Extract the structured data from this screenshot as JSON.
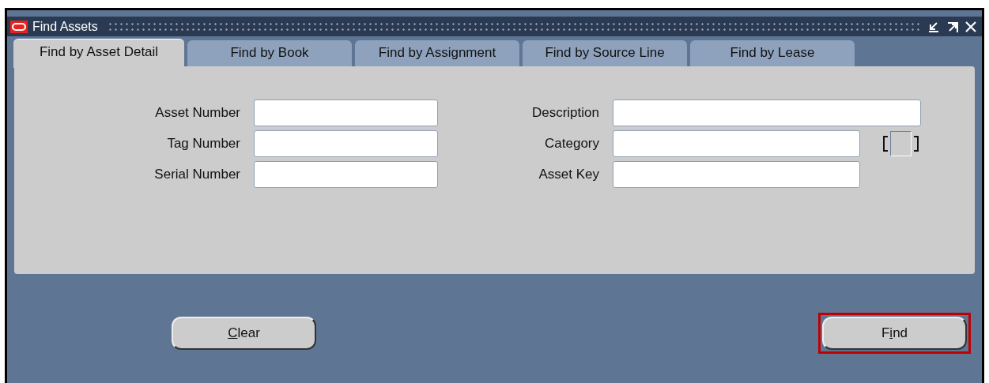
{
  "window": {
    "title": "Find Assets"
  },
  "tabs": [
    {
      "label": "Find by Asset Detail",
      "selected": true
    },
    {
      "label": "Find by Book",
      "selected": false
    },
    {
      "label": "Find by Assignment",
      "selected": false
    },
    {
      "label": "Find by Source Line",
      "selected": false
    },
    {
      "label": "Find by Lease",
      "selected": false
    }
  ],
  "left_fields": [
    {
      "label": "Asset Number"
    },
    {
      "label": "Tag Number"
    },
    {
      "label": "Serial Number"
    }
  ],
  "right_fields": [
    {
      "label": "Description",
      "kind": "long"
    },
    {
      "label": "Category",
      "kind": "flexfield"
    },
    {
      "label": "Asset Key",
      "kind": "text"
    }
  ],
  "buttons": [
    {
      "label": [
        {
          "text": "C",
          "underlined": true
        },
        {
          "text": "lear",
          "underlined": false
        }
      ],
      "highlighted": false
    },
    {
      "label": [
        {
          "text": "F",
          "underlined": false
        },
        {
          "text": "i",
          "underlined": true
        },
        {
          "text": "nd",
          "underlined": false
        }
      ],
      "highlighted": true
    }
  ]
}
